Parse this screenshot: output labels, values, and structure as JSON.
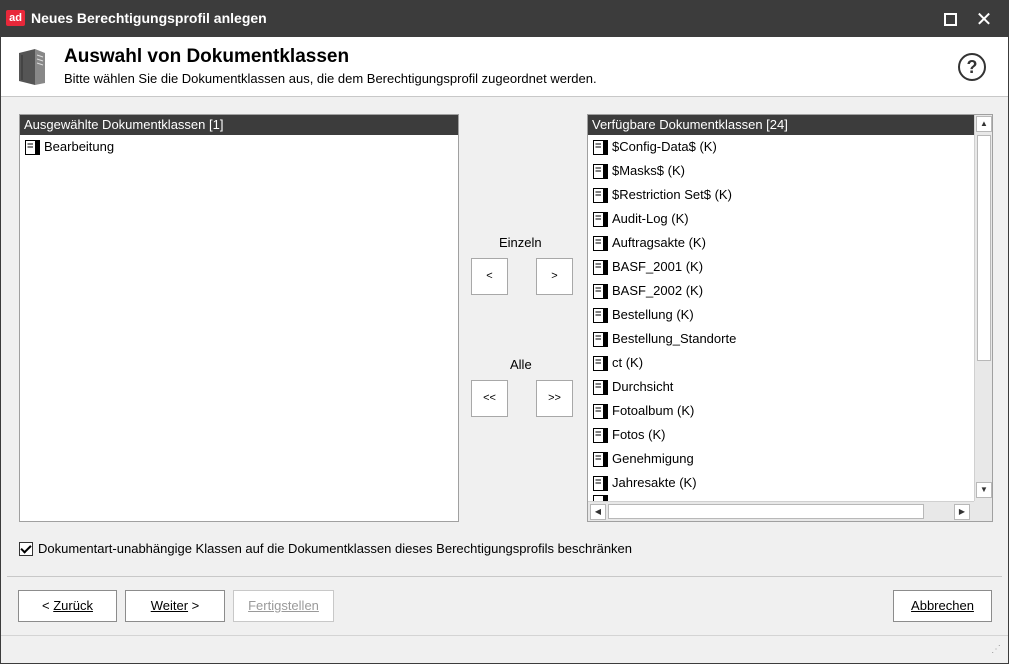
{
  "window": {
    "logo_text": "ad",
    "title": "Neues Berechtigungsprofil anlegen",
    "maximize_icon": "maximize-icon",
    "close_icon": "close-icon",
    "close_glyph": "✕"
  },
  "header": {
    "title": "Auswahl von Dokumentklassen",
    "subtitle": "Bitte wählen Sie die Dokumentklassen aus, die dem Berechtigungsprofil zugeordnet werden.",
    "help_glyph": "?"
  },
  "selected": {
    "header": "Ausgewählte Dokumentklassen [1]",
    "items": [
      "Bearbeitung"
    ]
  },
  "available": {
    "header": "Verfügbare Dokumentklassen [24]",
    "items": [
      "$Config-Data$ (K)",
      "$Masks$ (K)",
      "$Restriction Set$ (K)",
      "Audit-Log (K)",
      "Auftragsakte (K)",
      "BASF_2001 (K)",
      "BASF_2002 (K)",
      "Bestellung (K)",
      "Bestellung_Standorte",
      "ct (K)",
      "Durchsicht",
      "Fotoalbum (K)",
      "Fotos (K)",
      "Genehmigung",
      "Jahresakte (K)"
    ]
  },
  "transfer": {
    "single_label": "Einzeln",
    "all_label": "Alle",
    "move_left": "<",
    "move_right": ">",
    "move_all_left": "<<",
    "move_all_right": ">>"
  },
  "options": {
    "restrict_checkbox_label": "Dokumentart-unabhängige Klassen auf die Dokumentklassen dieses Berechtigungsprofils beschränken",
    "restrict_checked": true
  },
  "footer": {
    "back_prefix": "< ",
    "back_label": "Zurück",
    "next_label": "Weiter",
    "next_suffix": " >",
    "finish_label": "Fertigstellen",
    "cancel_label": "Abbrechen"
  },
  "colors": {
    "titlebar": "#3c3c3c",
    "logo": "#e8283a"
  }
}
